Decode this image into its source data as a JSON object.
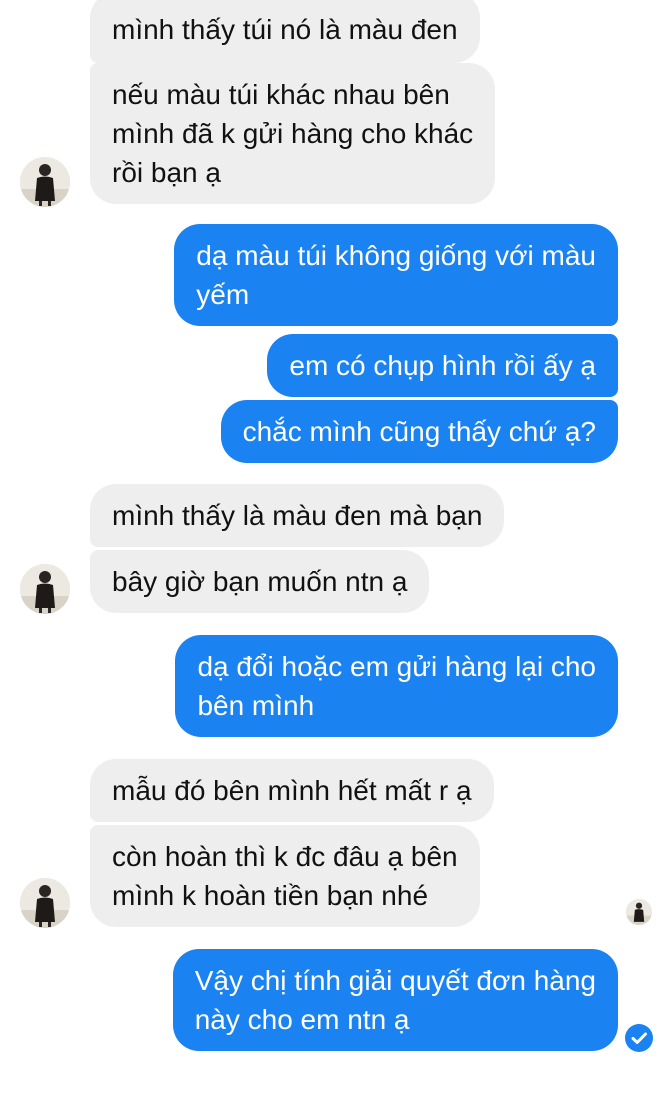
{
  "conversation": {
    "messages": [
      {
        "sender": "other",
        "lines": [
          "mình thấy túi nó là màu đen"
        ]
      },
      {
        "sender": "other",
        "lines": [
          "nếu màu túi khác nhau bên",
          "mình đã k gửi hàng cho khác",
          "rồi bạn ạ"
        ]
      },
      {
        "sender": "me",
        "lines": [
          "dạ màu túi không giống với màu",
          "yếm"
        ]
      },
      {
        "sender": "me",
        "lines": [
          "em có chụp hình rồi ấy ạ"
        ]
      },
      {
        "sender": "me",
        "lines": [
          "chắc mình cũng thấy chứ ạ?"
        ]
      },
      {
        "sender": "other",
        "lines": [
          "mình thấy là màu đen mà bạn"
        ]
      },
      {
        "sender": "other",
        "lines": [
          "bây giờ bạn muốn ntn ạ"
        ]
      },
      {
        "sender": "me",
        "lines": [
          "dạ đổi hoặc em gửi hàng lại cho",
          "bên mình"
        ]
      },
      {
        "sender": "other",
        "lines": [
          "mẫu đó bên mình hết mất r ạ"
        ]
      },
      {
        "sender": "other",
        "lines": [
          "còn hoàn thì k đc đâu ạ bên",
          "mình k hoàn tiền bạn nhé"
        ]
      },
      {
        "sender": "me",
        "lines": [
          "Vậy chị tính giải quyết đơn hàng",
          "này cho em ntn ạ"
        ]
      }
    ],
    "seen_avatar_icon": "contact-avatar-icon",
    "delivered_status_icon": "check-circle-icon"
  },
  "colors": {
    "incoming_bubble": "#eeeeef",
    "incoming_text": "#111111",
    "outgoing_bubble": "#1b82f2",
    "outgoing_text": "#ffffff"
  }
}
